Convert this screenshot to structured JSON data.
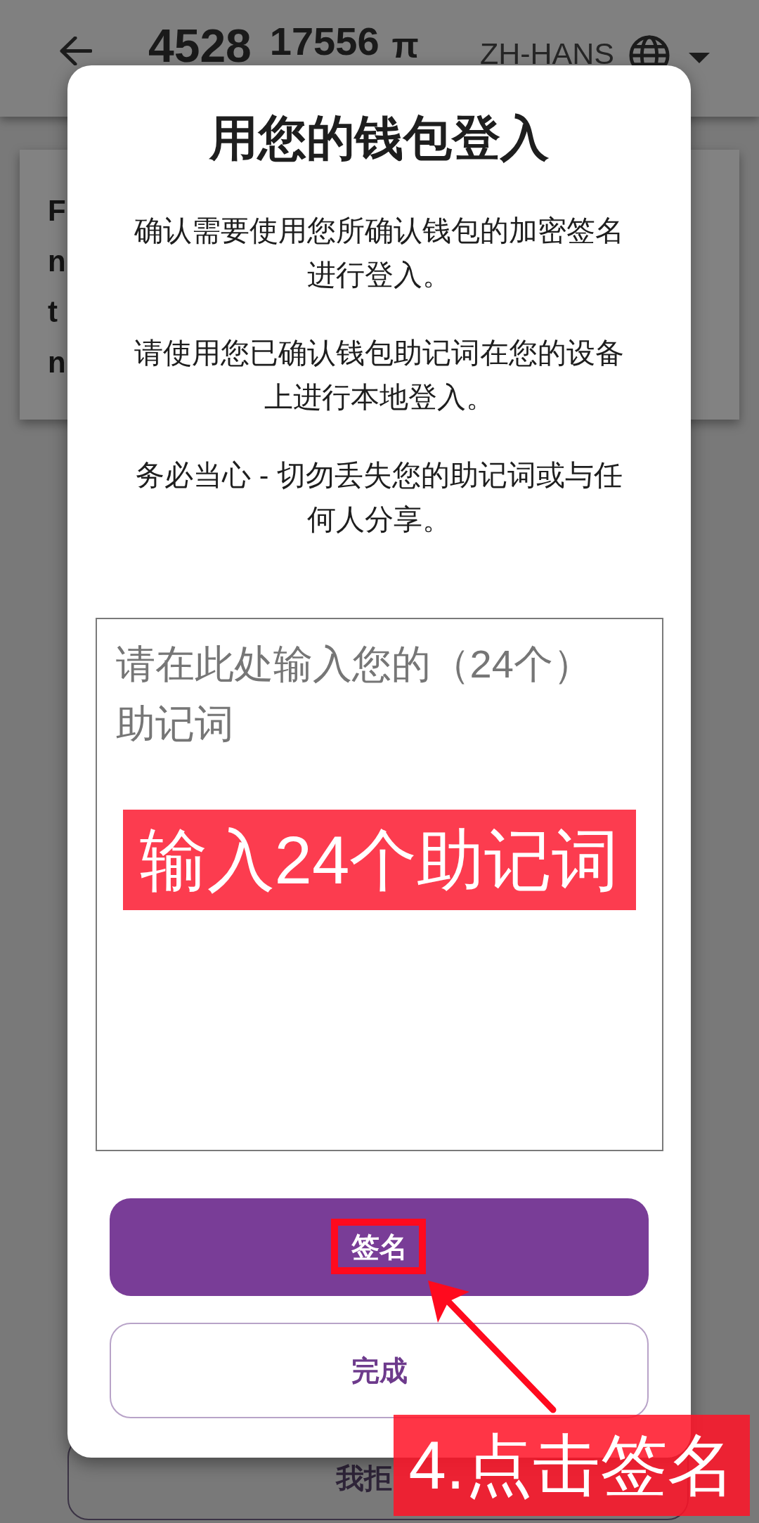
{
  "app_bar": {
    "balance_integer": "4528",
    "balance_decimals": "17556",
    "currency_symbol": "π",
    "language": "ZH-HANS"
  },
  "background_card": {
    "lines": [
      "F",
      "n",
      "t",
      "n"
    ]
  },
  "background_button": {
    "label": "我拒"
  },
  "dialog": {
    "title": "用您的钱包登入",
    "paragraphs": [
      "确认需要使用您所确认钱包的加密签名进行登入。",
      "请使用您已确认钱包助记词在您的设备上进行本地登入。",
      "务必当心 - 切勿丢失您的助记词或与任何人分享。"
    ],
    "mnemonic_field": {
      "placeholder": "请在此处输入您的（24个）助记词"
    },
    "buttons": [
      {
        "label": "签名",
        "kind": "primary"
      },
      {
        "label": "完成",
        "kind": "secondary"
      }
    ]
  },
  "annotations": {
    "field_note": "输入24个助记词",
    "step_note": "4.点击签名"
  }
}
